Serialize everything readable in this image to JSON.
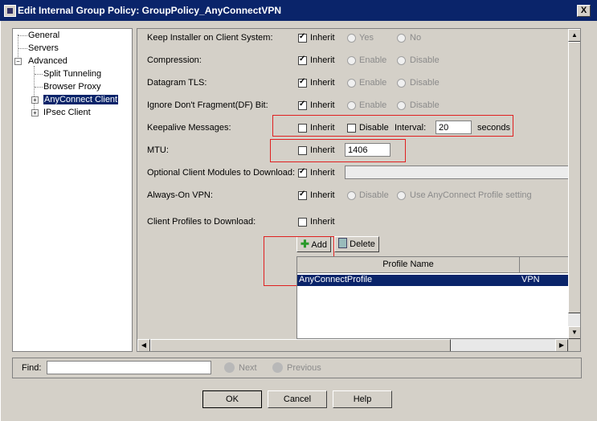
{
  "window": {
    "title": "Edit Internal Group Policy: GroupPolicy_AnyConnectVPN",
    "close_label": "X"
  },
  "tree": {
    "items": [
      {
        "label": "General"
      },
      {
        "label": "Servers"
      },
      {
        "label": "Advanced",
        "expander": "−"
      },
      {
        "label": "Split Tunneling"
      },
      {
        "label": "Browser Proxy"
      },
      {
        "label": "AnyConnect Client",
        "expander": "+",
        "selected": true
      },
      {
        "label": "IPsec Client",
        "expander": "+"
      }
    ]
  },
  "settings": {
    "keep_installer": {
      "label": "Keep Installer on Client System:",
      "inherit": "Inherit",
      "opt1": "Yes",
      "opt2": "No"
    },
    "compression": {
      "label": "Compression:",
      "inherit": "Inherit",
      "opt1": "Enable",
      "opt2": "Disable"
    },
    "datagram_tls": {
      "label": "Datagram TLS:",
      "inherit": "Inherit",
      "opt1": "Enable",
      "opt2": "Disable"
    },
    "ignore_df": {
      "label": "Ignore Don't Fragment(DF) Bit:",
      "inherit": "Inherit",
      "opt1": "Enable",
      "opt2": "Disable"
    },
    "keepalive": {
      "label": "Keepalive Messages:",
      "inherit": "Inherit",
      "disable": "Disable",
      "interval_label": "Interval:",
      "interval_value": "20",
      "unit": "seconds"
    },
    "mtu": {
      "label": "MTU:",
      "inherit": "Inherit",
      "value": "1406"
    },
    "optional_modules": {
      "label": "Optional Client Modules to Download:",
      "inherit": "Inherit",
      "value": ""
    },
    "always_on": {
      "label": "Always-On VPN:",
      "inherit": "Inherit",
      "opt1": "Disable",
      "opt2": "Use AnyConnect Profile setting"
    },
    "client_profiles": {
      "label": "Client Profiles to Download:",
      "inherit": "Inherit"
    }
  },
  "profiles": {
    "add_label": "Add",
    "delete_label": "Delete",
    "columns": [
      "Profile Name",
      ""
    ],
    "rows": [
      {
        "name": "AnyConnectProfile",
        "type": "VPN"
      }
    ]
  },
  "find": {
    "label": "Find:",
    "value": "",
    "next_label": "Next",
    "previous_label": "Previous"
  },
  "footer": {
    "ok_label": "OK",
    "cancel_label": "Cancel",
    "help_label": "Help"
  },
  "colors": {
    "titlebar": "#0a246a",
    "highlight_box": "#e02020",
    "add_icon": "#2a9a2a"
  }
}
